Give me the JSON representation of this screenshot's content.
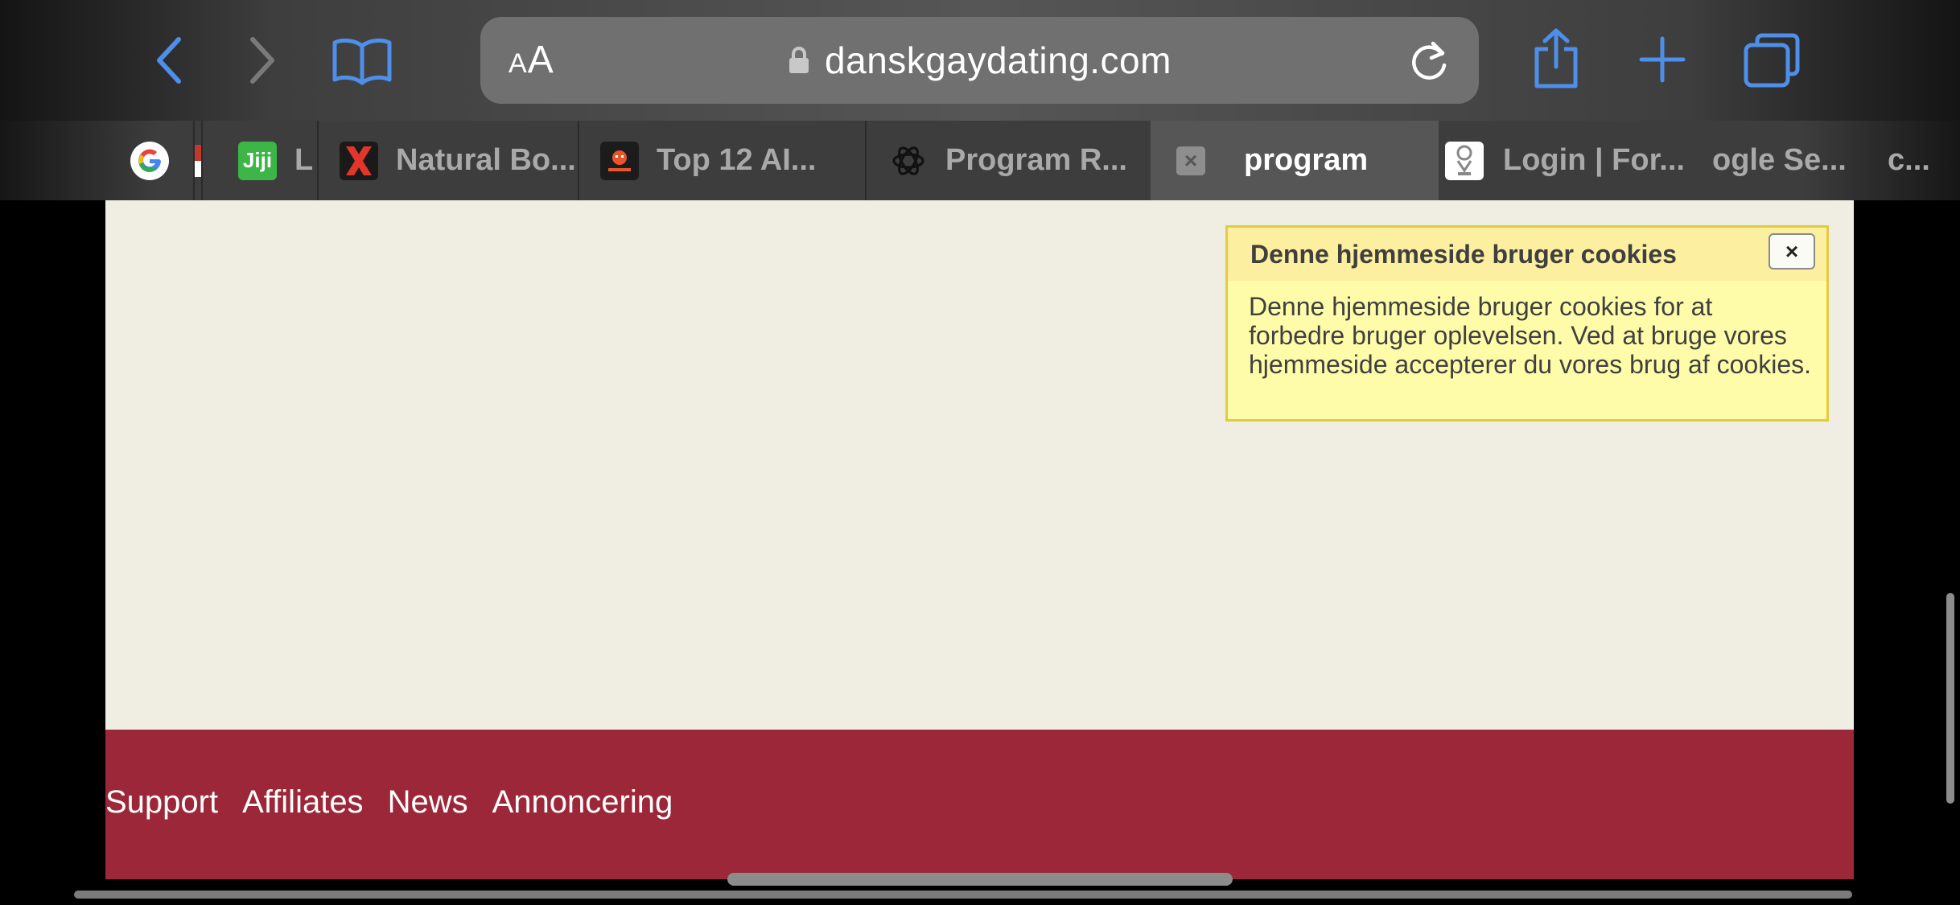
{
  "browser": {
    "url": "danskgaydating.com",
    "reader_label_small": "A",
    "reader_label_large": "A",
    "accent_color": "#4d8fe9",
    "toolbar_icons": [
      "back-icon",
      "forward-icon",
      "bookmarks-icon",
      "lock-icon",
      "reload-icon",
      "share-icon",
      "new-tab-icon",
      "tabs-overview-icon"
    ]
  },
  "tabs": [
    {
      "label": "",
      "favicon": "google-icon"
    },
    {
      "label": "",
      "favicon": "flag-icon"
    },
    {
      "label": "L",
      "favicon": "jiji-icon",
      "favicon_text": "Jiji"
    },
    {
      "label": "Natural Bo...",
      "favicon": "x-logo-icon"
    },
    {
      "label": "Top 12 AI...",
      "favicon": "robot-icon"
    },
    {
      "label": "Program R...",
      "favicon": "openai-icon"
    },
    {
      "label": "program",
      "favicon": "close-tab-icon",
      "active": true
    },
    {
      "label": "Login | For...",
      "favicon": "trophy-icon"
    },
    {
      "label": "ogle Se...",
      "favicon": ""
    },
    {
      "label": "c...",
      "favicon": ""
    }
  ],
  "page": {
    "background": "#f0eee3",
    "cookie_banner": {
      "title": "Denne hjemmeside bruger cookies",
      "close_label": "×",
      "text": "Denne hjemmeside bruger cookies for at forbedre bruger oplevelsen. Ved at bruge vores hjemmeside accepterer du vores brug af cookies."
    },
    "footer": {
      "color": "#9c2739",
      "links": [
        "Support",
        "Affiliates",
        "News",
        "Annoncering"
      ]
    }
  }
}
